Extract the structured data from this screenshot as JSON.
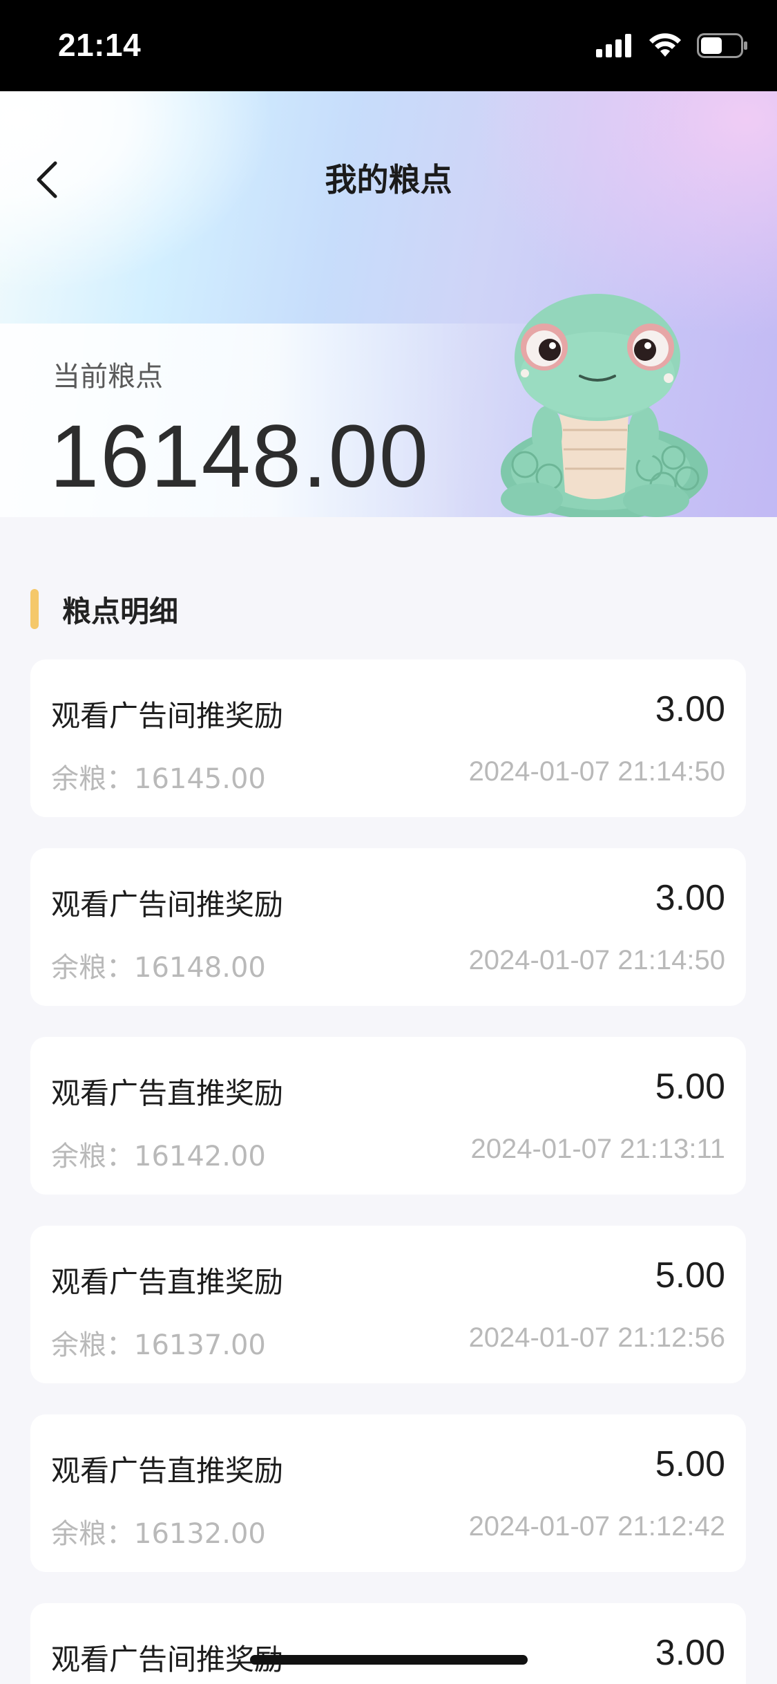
{
  "status_bar": {
    "time": "21:14",
    "icons": [
      "signal-icon",
      "wifi-icon",
      "battery-icon"
    ]
  },
  "header": {
    "title": "我的粮点",
    "back_icon": "chevron-left-icon"
  },
  "balance": {
    "label": "当前粮点",
    "value": "16148.00"
  },
  "section": {
    "title": "粮点明细",
    "accent_color": "#f5c86a"
  },
  "records": [
    {
      "title": "观看广告间推奖励",
      "amount": "3.00",
      "balance": "余粮：16145.00",
      "time": "2024-01-07 21:14:50"
    },
    {
      "title": "观看广告间推奖励",
      "amount": "3.00",
      "balance": "余粮：16148.00",
      "time": "2024-01-07 21:14:50"
    },
    {
      "title": "观看广告直推奖励",
      "amount": "5.00",
      "balance": "余粮：16142.00",
      "time": "2024-01-07 21:13:11"
    },
    {
      "title": "观看广告直推奖励",
      "amount": "5.00",
      "balance": "余粮：16137.00",
      "time": "2024-01-07 21:12:56"
    },
    {
      "title": "观看广告直推奖励",
      "amount": "5.00",
      "balance": "余粮：16132.00",
      "time": "2024-01-07 21:12:42"
    },
    {
      "title": "观看广告间推奖励",
      "amount": "3.00",
      "balance": "",
      "time": ""
    }
  ]
}
